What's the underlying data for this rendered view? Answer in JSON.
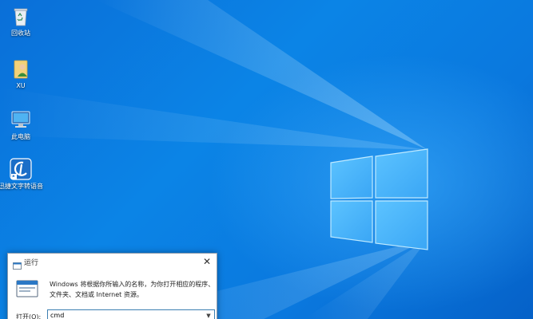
{
  "desktop": {
    "icons": [
      {
        "label": "回收站",
        "icon": "recycle-bin-icon"
      },
      {
        "label": "XU",
        "icon": "user-folder-icon"
      },
      {
        "label": "此电脑",
        "icon": "this-pc-icon"
      },
      {
        "label": "迅捷文字转语音",
        "icon": "text-to-speech-app-icon"
      }
    ],
    "colors": {
      "wallpaper": "#0a78de",
      "logo_light": "#7fd4ff"
    }
  },
  "run_dialog": {
    "title": "运行",
    "description_line1": "Windows 将根据你所输入的名称，为你打开相应的程序、",
    "description_line2": "文件夹、文档或 Internet 资源。",
    "open_label": "打开(O):",
    "input_value": "cmd",
    "close_glyph": "✕",
    "dropdown_glyph": "▼",
    "icons": {
      "title": "run-icon",
      "big": "run-icon",
      "close": "close-icon",
      "dropdown": "chevron-down-icon"
    }
  }
}
